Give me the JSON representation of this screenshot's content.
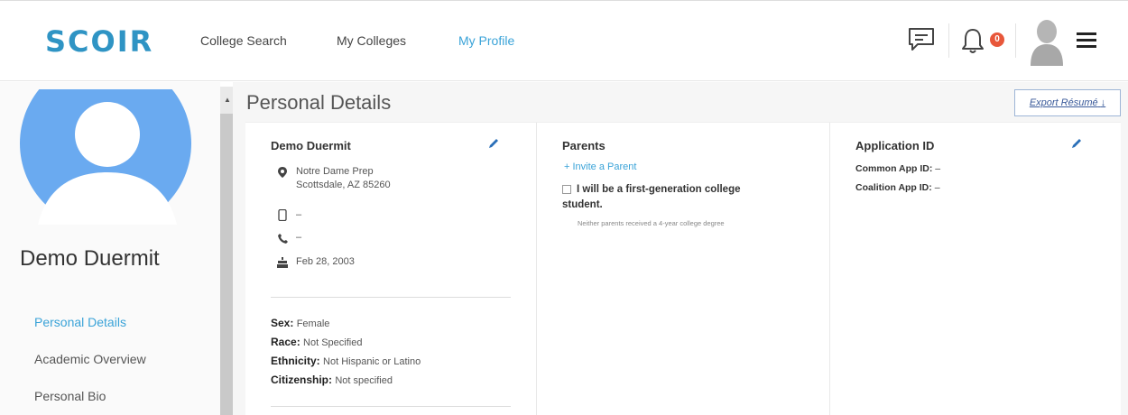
{
  "header": {
    "logo": "SCOIR",
    "nav": [
      "College Search",
      "My Colleges",
      "My Profile"
    ],
    "notification_count": "0",
    "icons": [
      "chat-icon",
      "bell-icon",
      "user-avatar-icon",
      "hamburger-menu-icon"
    ]
  },
  "sidebar": {
    "name": "Demo Duermit",
    "items": [
      "Personal Details",
      "Academic Overview",
      "Personal Bio"
    ]
  },
  "main": {
    "title": "Personal Details",
    "export_label": "Export Résumé",
    "student": {
      "name": "Demo Duermit",
      "school": "Notre Dame Prep",
      "city": "Scottsdale, AZ 85260",
      "mobile": "–",
      "phone": "–",
      "birthday": "Feb 28, 2003",
      "sex_label": "Sex:",
      "sex": "Female",
      "race_label": "Race:",
      "race": "Not Specified",
      "ethnicity_label": "Ethnicity:",
      "ethnicity": "Not Hispanic or Latino",
      "citizenship_label": "Citizenship:",
      "citizenship": "Not specified"
    },
    "parents": {
      "title": "Parents",
      "invite": "+ Invite a Parent",
      "first_gen": "I will be a first-generation college student.",
      "first_gen_note": "Neither parents received a 4-year college degree"
    },
    "application": {
      "title": "Application ID",
      "common_label": "Common App ID:",
      "common": "–",
      "coalition_label": "Coalition App ID:",
      "coalition": "–"
    }
  },
  "colors": {
    "accent": "#3aa3d8",
    "logo": "#2f94c4",
    "badge": "#e8573a",
    "avatar": "#6aaaf0"
  }
}
